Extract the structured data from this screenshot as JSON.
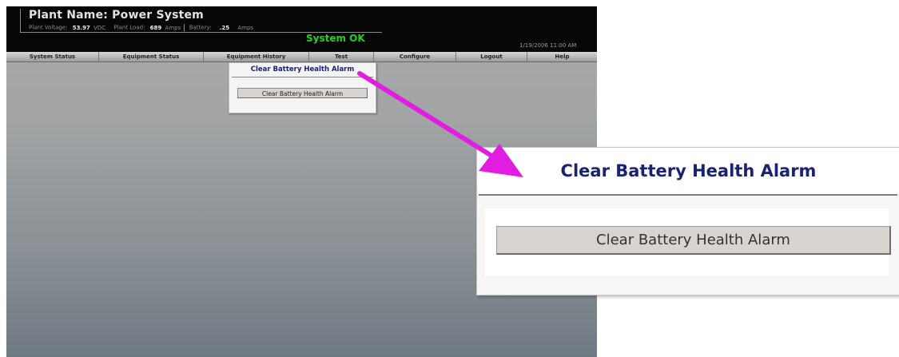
{
  "header": {
    "plant_name_label": "Plant Name:",
    "plant_name": "Power System",
    "metrics": [
      {
        "label": "Plant Voltage:",
        "value": "53.97",
        "unit": "VDC"
      },
      {
        "label": "Plant Load:",
        "value": "689",
        "unit": "Amps"
      },
      {
        "label": "Battery:",
        "value": ".25",
        "unit": "Amps"
      }
    ],
    "system_status": "System OK",
    "timestamp": "1/19/2006 11:00 AM"
  },
  "nav": {
    "items": [
      {
        "label": "System Status"
      },
      {
        "label": "Equipment Status"
      },
      {
        "label": "Equipment History"
      },
      {
        "label": "Test"
      },
      {
        "label": "Configure"
      },
      {
        "label": "Logout"
      },
      {
        "label": "Help"
      }
    ]
  },
  "dropdown": {
    "title": "Clear Battery Health Alarm",
    "button_label": "Clear Battery Health Alarm"
  },
  "zoom": {
    "title": "Clear Battery Health Alarm",
    "button_label": "Clear Battery Health Alarm"
  },
  "colors": {
    "status_ok": "#1ed31e",
    "title_text": "#1a2274",
    "arrow": "#e21de2",
    "header_bg": "#060606"
  }
}
